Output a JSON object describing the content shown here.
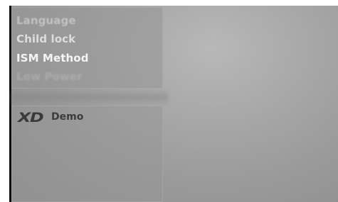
{
  "menu": {
    "items": [
      {
        "label": "Language"
      },
      {
        "label": "Child lock"
      },
      {
        "label": "ISM Method"
      },
      {
        "label": "Low Power"
      }
    ],
    "selected_index": 2
  },
  "demo": {
    "logo_text": "XD",
    "label": "Demo"
  },
  "colors": {
    "background": "#a3a3a3",
    "panel": "#969696",
    "text_active": "#f4f4f4",
    "logo": "#3a3a3a"
  }
}
